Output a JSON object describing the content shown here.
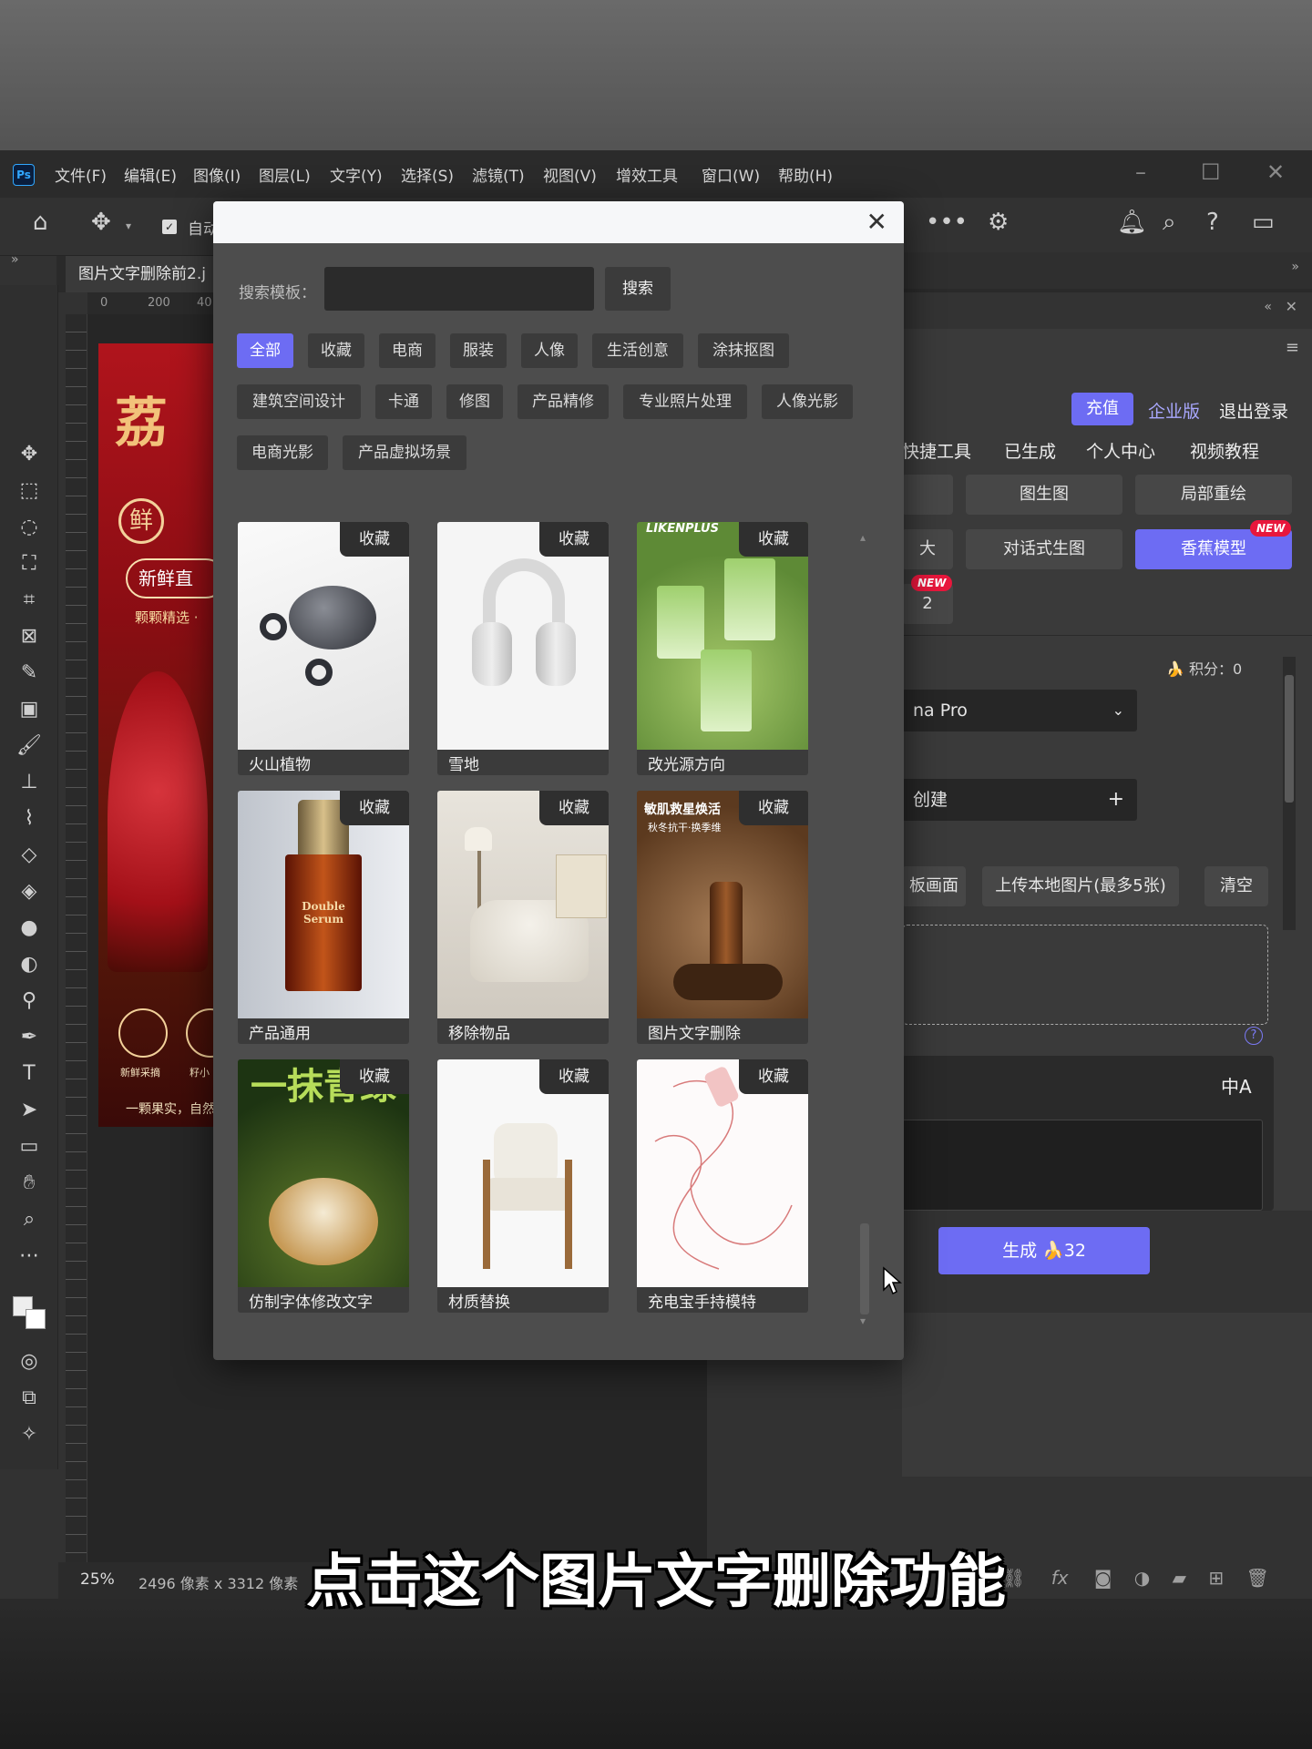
{
  "menubar": {
    "logo": "Ps",
    "items": [
      "文件(F)",
      "编辑(E)",
      "图像(I)",
      "图层(L)",
      "文字(Y)",
      "选择(S)",
      "滤镜(T)",
      "视图(V)",
      "增效工具",
      "窗口(W)",
      "帮助(H)"
    ]
  },
  "options": {
    "auto_label": "自动"
  },
  "doc": {
    "tab_title": "图片文字删除前2.j",
    "zoom": "25%",
    "size_info": "2496 像素 x 3312 像素"
  },
  "rulers": {
    "h_ticks": [
      "0",
      "200",
      "40"
    ]
  },
  "artwork": {
    "title": "荔",
    "seal": "鲜",
    "badge": "新鲜直",
    "sub": "颗颗精选 ·",
    "icon_labels": [
      "新鲜采摘",
      "籽小"
    ],
    "footer": "一颗果实，自然"
  },
  "right_panel": {
    "recharge": "充值",
    "enterprise": "企业版",
    "logout": "退出登录",
    "nav": [
      "快捷工具",
      "已生成",
      "个人中心",
      "视频教程"
    ],
    "row1": [
      "图生图",
      "局部重绘"
    ],
    "row2": [
      "对话式生图",
      "香蕉模型"
    ],
    "partial_left_row2": "大",
    "partial_left_row3": "2",
    "new_tag": "NEW",
    "points_label": "🍌 积分：0",
    "model_value": "na Pro",
    "create_value": "创建",
    "partial_canvas_btn": "板画面",
    "upload_btn": "上传本地图片(最多5张)",
    "clear_btn": "清空",
    "translate_icon": "中A",
    "generate_btn": "生成 🍌32"
  },
  "dialog": {
    "search_label": "搜索模板：",
    "search_value": "",
    "search_button": "搜索",
    "categories_row1": [
      "全部",
      "收藏",
      "电商",
      "服装",
      "人像",
      "生活创意",
      "涂抹抠图"
    ],
    "categories_row2": [
      "建筑空间设计",
      "卡通",
      "修图",
      "产品精修",
      "专业照片处理",
      "人像光影"
    ],
    "categories_row3": [
      "电商光影",
      "产品虚拟场景"
    ],
    "fav_label": "收藏",
    "cards": [
      {
        "label": "火山植物",
        "art": "earbuds"
      },
      {
        "label": "雪地",
        "art": "headphones"
      },
      {
        "label": "改光源方向",
        "art": "matcha",
        "brand": "LIKENPLUS"
      },
      {
        "label": "产品通用",
        "art": "serum",
        "text": "Double Serum"
      },
      {
        "label": "移除物品",
        "art": "sofa"
      },
      {
        "label": "图片文字删除",
        "art": "bottle",
        "text": "敏肌救星焕活",
        "sub": "秋冬抗干·换季维"
      },
      {
        "label": "仿制字体修改文字",
        "art": "puff",
        "text": "一抹青绿"
      },
      {
        "label": "材质替换",
        "art": "chair"
      },
      {
        "label": "充电宝手持模特",
        "art": "sketch"
      }
    ]
  },
  "caption": "点击这个图片文字删除功能",
  "colors": {
    "accent": "#6d6cf3",
    "new_tag": "#e8173c"
  }
}
